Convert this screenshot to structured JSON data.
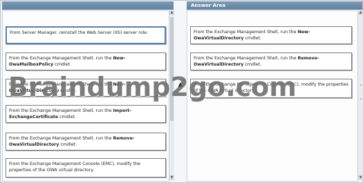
{
  "answer_area": {
    "title": "Answer Area"
  },
  "left_options": [
    {
      "pre": "From Server Manager, reinstall the Web Server (IIS) server role.",
      "bold": "",
      "post": ""
    },
    {
      "pre": "From the Exchange Management Shell, run the ",
      "bold": "New-OwaMailboxPolicy",
      "post": " cmdlet."
    },
    {
      "pre": "From the Exchange Management Shell, run the ",
      "bold": "New-OwaVirtualDirectory",
      "post": " cmdlet."
    },
    {
      "pre": "From the Exchange Management Shell, run the ",
      "bold": "Import-ExchangeCertificate",
      "post": " cmdlet."
    },
    {
      "pre": "From the Exchange Management Shell, run the ",
      "bold": "Remove-OwaVirtualDirectory",
      "post": " cmdlet."
    },
    {
      "pre": "From the Exchange Management Console (EMC), modify the properties of the OWA virtual directory.",
      "bold": "",
      "post": ""
    }
  ],
  "answer_options": [
    {
      "pre": "From the Exchange Management Shell, run the ",
      "bold": "New-OwaVirtualDirectory",
      "post": " cmdlet."
    },
    {
      "pre": "From the Exchange Management Shell, run the ",
      "bold": "Remove-OwaVirtualDirectory",
      "post": " cmdlet."
    },
    {
      "pre": "From the Exchange Management Console (EMC), modify the properties of the OWA virtual directory.",
      "bold": "",
      "post": ""
    }
  ],
  "controls": {
    "move_arrow": "▲",
    "up": "▲",
    "down": "▼",
    "chevron": "›"
  },
  "watermark": {
    "text": "Braindump2go.com"
  }
}
